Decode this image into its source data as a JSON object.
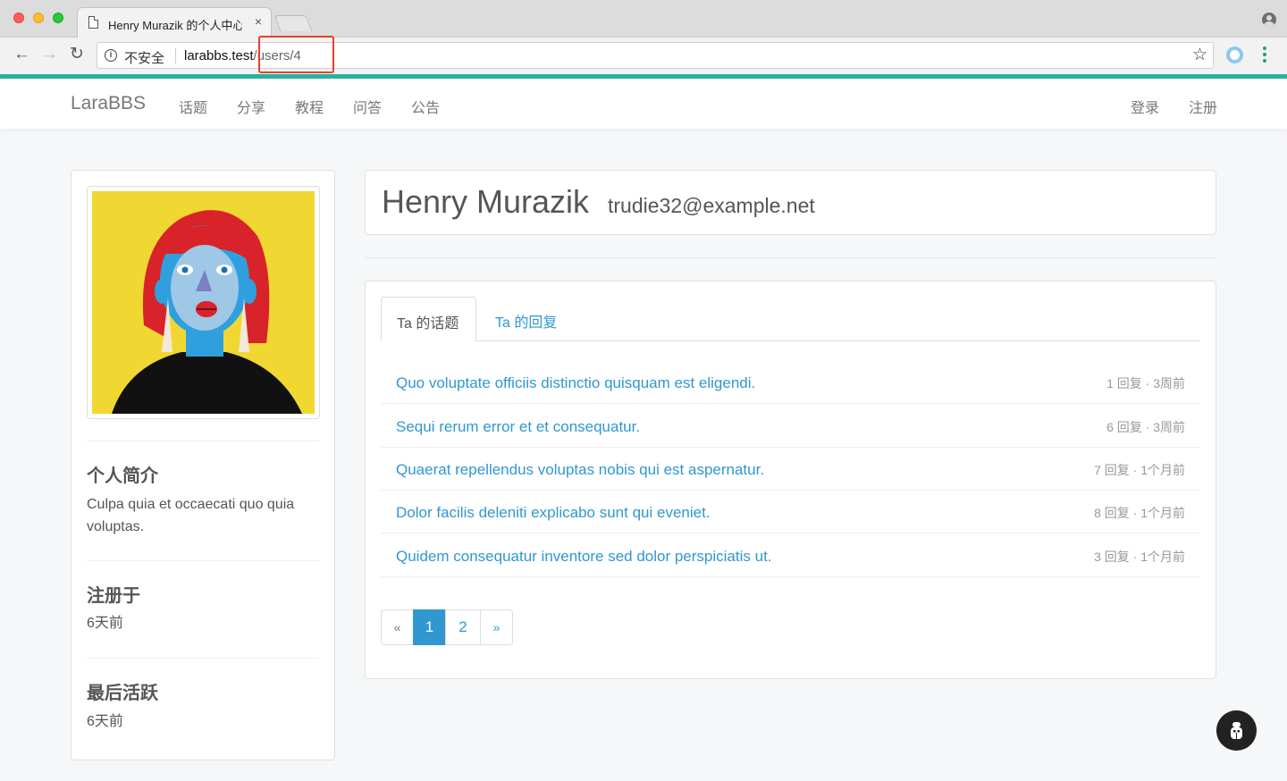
{
  "browser": {
    "tab_title": "Henry Murazik 的个人中心",
    "tab_close": "×",
    "security_label": "不安全",
    "url_host": "larabbs.test",
    "url_path": "/users/4"
  },
  "icons": {
    "back": "arrow-left-icon",
    "forward": "arrow-right-icon",
    "reload": "reload-icon",
    "info": "info-icon",
    "star": "star-icon",
    "extension": "extension-icon",
    "menu": "kebab-menu-icon",
    "profile": "profile-icon",
    "fab": "bug-icon"
  },
  "colors": {
    "accent": "#3097d1",
    "teal_bar": "#2bb3a0",
    "url_highlight": "#e8402a"
  },
  "navbar": {
    "brand": "LaraBBS",
    "links": [
      "话题",
      "分享",
      "教程",
      "问答",
      "公告"
    ],
    "login": "登录",
    "register": "注册"
  },
  "sidebar": {
    "bio_heading": "个人简介",
    "bio_text": "Culpa quia et occaecati quo quia voluptas.",
    "registered_heading": "注册于",
    "registered_value": "6天前",
    "last_active_heading": "最后活跃",
    "last_active_value": "6天前"
  },
  "profile": {
    "name": "Henry Murazik",
    "email": "trudie32@example.net"
  },
  "tabs": {
    "topics": "Ta 的话题",
    "replies": "Ta 的回复"
  },
  "topics": [
    {
      "title": "Quo voluptate officiis distinctio quisquam est eligendi.",
      "meta": "1 回复 · 3周前"
    },
    {
      "title": "Sequi rerum error et et consequatur.",
      "meta": "6 回复 · 3周前"
    },
    {
      "title": "Quaerat repellendus voluptas nobis qui est aspernatur.",
      "meta": "7 回复 · 1个月前"
    },
    {
      "title": "Dolor facilis deleniti explicabo sunt qui eveniet.",
      "meta": "8 回复 · 1个月前"
    },
    {
      "title": "Quidem consequatur inventore sed dolor perspiciatis ut.",
      "meta": "3 回复 · 1个月前"
    }
  ],
  "pagination": {
    "prev": "«",
    "pages": [
      "1",
      "2"
    ],
    "current": "1",
    "next": "»"
  }
}
